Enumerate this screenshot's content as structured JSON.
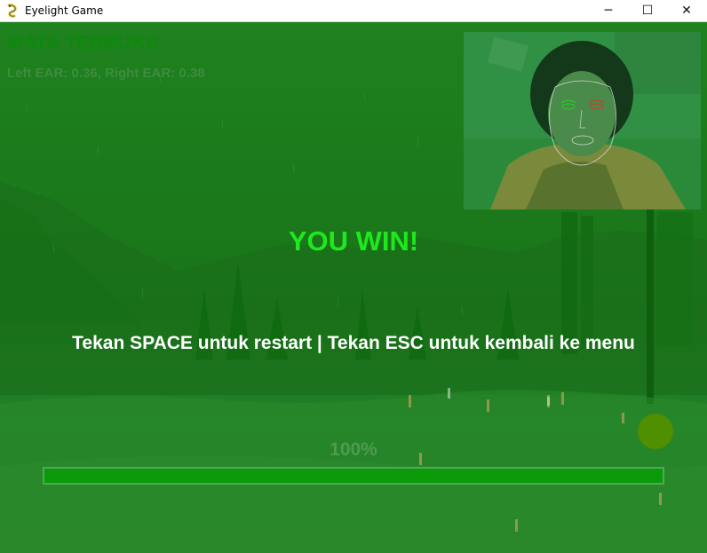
{
  "window": {
    "title": "Eyelight Game",
    "icon": "pygame-snake-icon",
    "controls": {
      "minimize": "─",
      "maximize": "☐",
      "close": "✕"
    }
  },
  "hud": {
    "status": "MATA TERBUKA",
    "ear_readout": "Left EAR: 0.36, Right EAR: 0.38"
  },
  "webcam": {
    "icon": "webcam-face-mesh-feed"
  },
  "overlay": {
    "result": "YOU WIN!",
    "instructions": "Tekan SPACE untuk restart | Tekan ESC untuk kembali ke menu"
  },
  "progress": {
    "label": "100%",
    "value": 1.0
  },
  "colors": {
    "win_text": "#1ee81e",
    "progress_fill": "#0a9a0a",
    "player_ball": "#4f8f00"
  }
}
